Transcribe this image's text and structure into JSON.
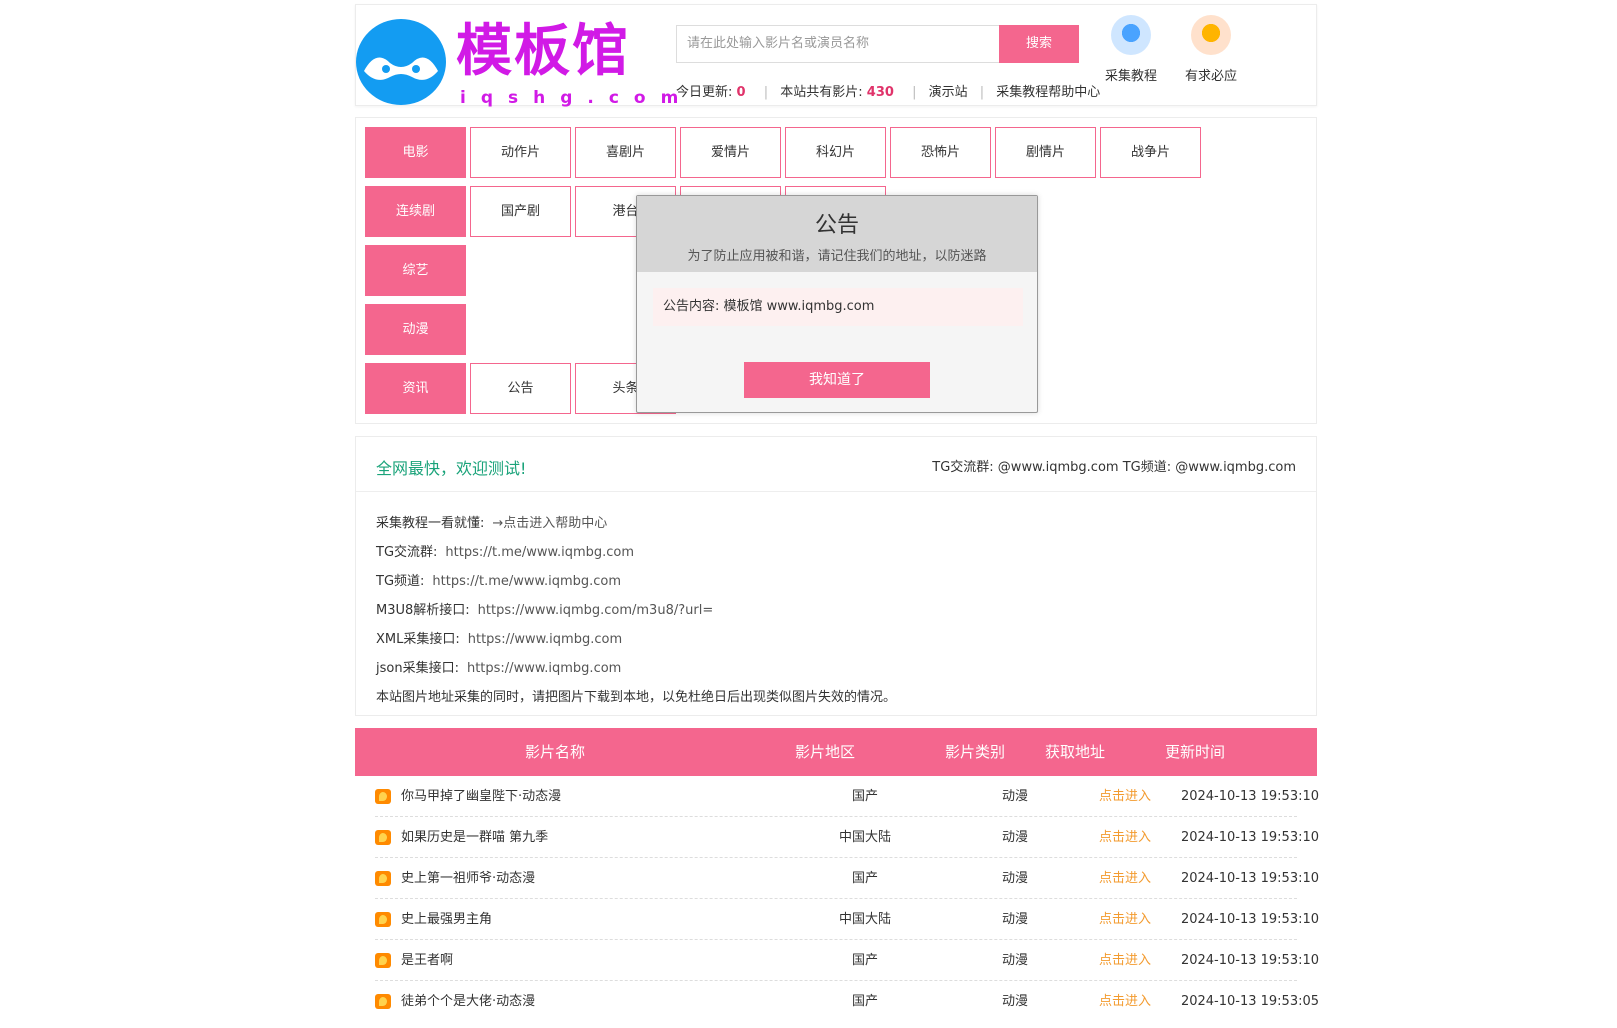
{
  "header": {
    "logo_text": "模板馆",
    "logo_sub": "iqshg.com",
    "search_placeholder": "请在此处输入影片名或演员名称",
    "search_button": "搜索",
    "today_label": "今日更新:",
    "today_count": "0",
    "total_label": "本站共有影片:",
    "total_count": "430",
    "demo_link": "演示站",
    "help_link": "采集教程帮助中心",
    "icon_links": [
      {
        "label": "采集教程",
        "icon": "lightbulb-icon",
        "color": "#4aa3ff"
      },
      {
        "label": "有求必应",
        "icon": "chat-bubble-icon",
        "color": "#ffb400"
      }
    ]
  },
  "nav": {
    "rows": [
      {
        "category": "电影",
        "items": [
          "动作片",
          "喜剧片",
          "爱情片",
          "科幻片",
          "恐怖片",
          "剧情片",
          "战争片"
        ]
      },
      {
        "category": "连续剧",
        "items": [
          "国产剧",
          "港台"
        ]
      },
      {
        "category": "综艺",
        "items": []
      },
      {
        "category": "动漫",
        "items": []
      },
      {
        "category": "资讯",
        "items": [
          "公告",
          "头条"
        ]
      }
    ]
  },
  "notice": {
    "title": "全网最快，欢迎测试!",
    "tg_text": "TG交流群:  @www.iqmbg.com TG频道: @www.iqmbg.com",
    "lines": [
      {
        "label": "采集教程一看就懂:",
        "value": "→点击进入帮助中心"
      },
      {
        "label": "TG交流群:",
        "value": "https://t.me/www.iqmbg.com"
      },
      {
        "label": "TG频道:",
        "value": "https://t.me/www.iqmbg.com"
      },
      {
        "label": "M3U8解析接口:",
        "value": "https://www.iqmbg.com/m3u8/?url="
      },
      {
        "label": "XML采集接口:",
        "value": "https://www.iqmbg.com"
      },
      {
        "label": "json采集接口:",
        "value": "https://www.iqmbg.com"
      },
      {
        "label": "本站图片地址采集的同时，请把图片下载到本地，以免杜绝日后出现类似图片失效的情况。",
        "value": ""
      }
    ]
  },
  "table": {
    "headers": [
      "影片名称",
      "影片地区",
      "影片类别",
      "获取地址",
      "更新时间"
    ],
    "rows": [
      {
        "name": "你马甲掉了幽皇陛下·动态漫",
        "area": "国产",
        "type": "动漫",
        "link": "点击进入",
        "time": "2024-10-13 19:53:10"
      },
      {
        "name": "如果历史是一群喵 第九季",
        "area": "中国大陆",
        "type": "动漫",
        "link": "点击进入",
        "time": "2024-10-13 19:53:10"
      },
      {
        "name": "史上第一祖师爷·动态漫",
        "area": "国产",
        "type": "动漫",
        "link": "点击进入",
        "time": "2024-10-13 19:53:10"
      },
      {
        "name": "史上最强男主角",
        "area": "中国大陆",
        "type": "动漫",
        "link": "点击进入",
        "time": "2024-10-13 19:53:10"
      },
      {
        "name": "是王者啊",
        "area": "国产",
        "type": "动漫",
        "link": "点击进入",
        "time": "2024-10-13 19:53:10"
      },
      {
        "name": "徒弟个个是大佬·动态漫",
        "area": "国产",
        "type": "动漫",
        "link": "点击进入",
        "time": "2024-10-13 19:53:05"
      }
    ]
  },
  "modal": {
    "title": "公告",
    "subtitle": "为了防止应用被和谐，请记住我们的地址，以防迷路",
    "body": "公告内容: 模板馆 www.iqmbg.com",
    "button": "我知道了"
  },
  "colors": {
    "accent": "#f4668e",
    "logo": "#d11ae6",
    "notice_title": "#1aa37a",
    "link": "#f39b2f"
  }
}
